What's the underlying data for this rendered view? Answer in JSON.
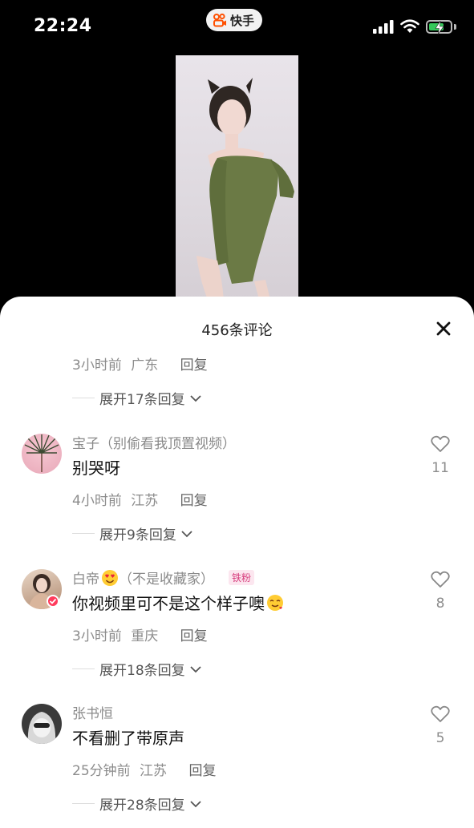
{
  "status_bar": {
    "time": "22:24",
    "app_name": "快手",
    "battery_percent": 70
  },
  "sheet": {
    "title": "456条评论"
  },
  "top_partial": {
    "meta_time": "3小时前",
    "meta_location": "广东",
    "reply_label": "回复",
    "expand_label": "展开17条回复"
  },
  "comments": [
    {
      "username": "宝子（别偷看我顶置视频）",
      "text": "别哭呀",
      "time": "4小时前",
      "location": "江苏",
      "reply_label": "回复",
      "likes": "11",
      "expand_label": "展开9条回复"
    },
    {
      "username": "白帝",
      "username_suffix": "（不是收藏家）",
      "badge": "铁粉",
      "text": "你视频里可不是这个样子噢",
      "time": "3小时前",
      "location": "重庆",
      "reply_label": "回复",
      "likes": "8",
      "expand_label": "展开18条回复"
    },
    {
      "username": "张书恒",
      "text": "不看删了带原声",
      "time": "25分钟前",
      "location": "江苏",
      "reply_label": "回复",
      "likes": "5",
      "expand_label": "展开28条回复"
    }
  ]
}
